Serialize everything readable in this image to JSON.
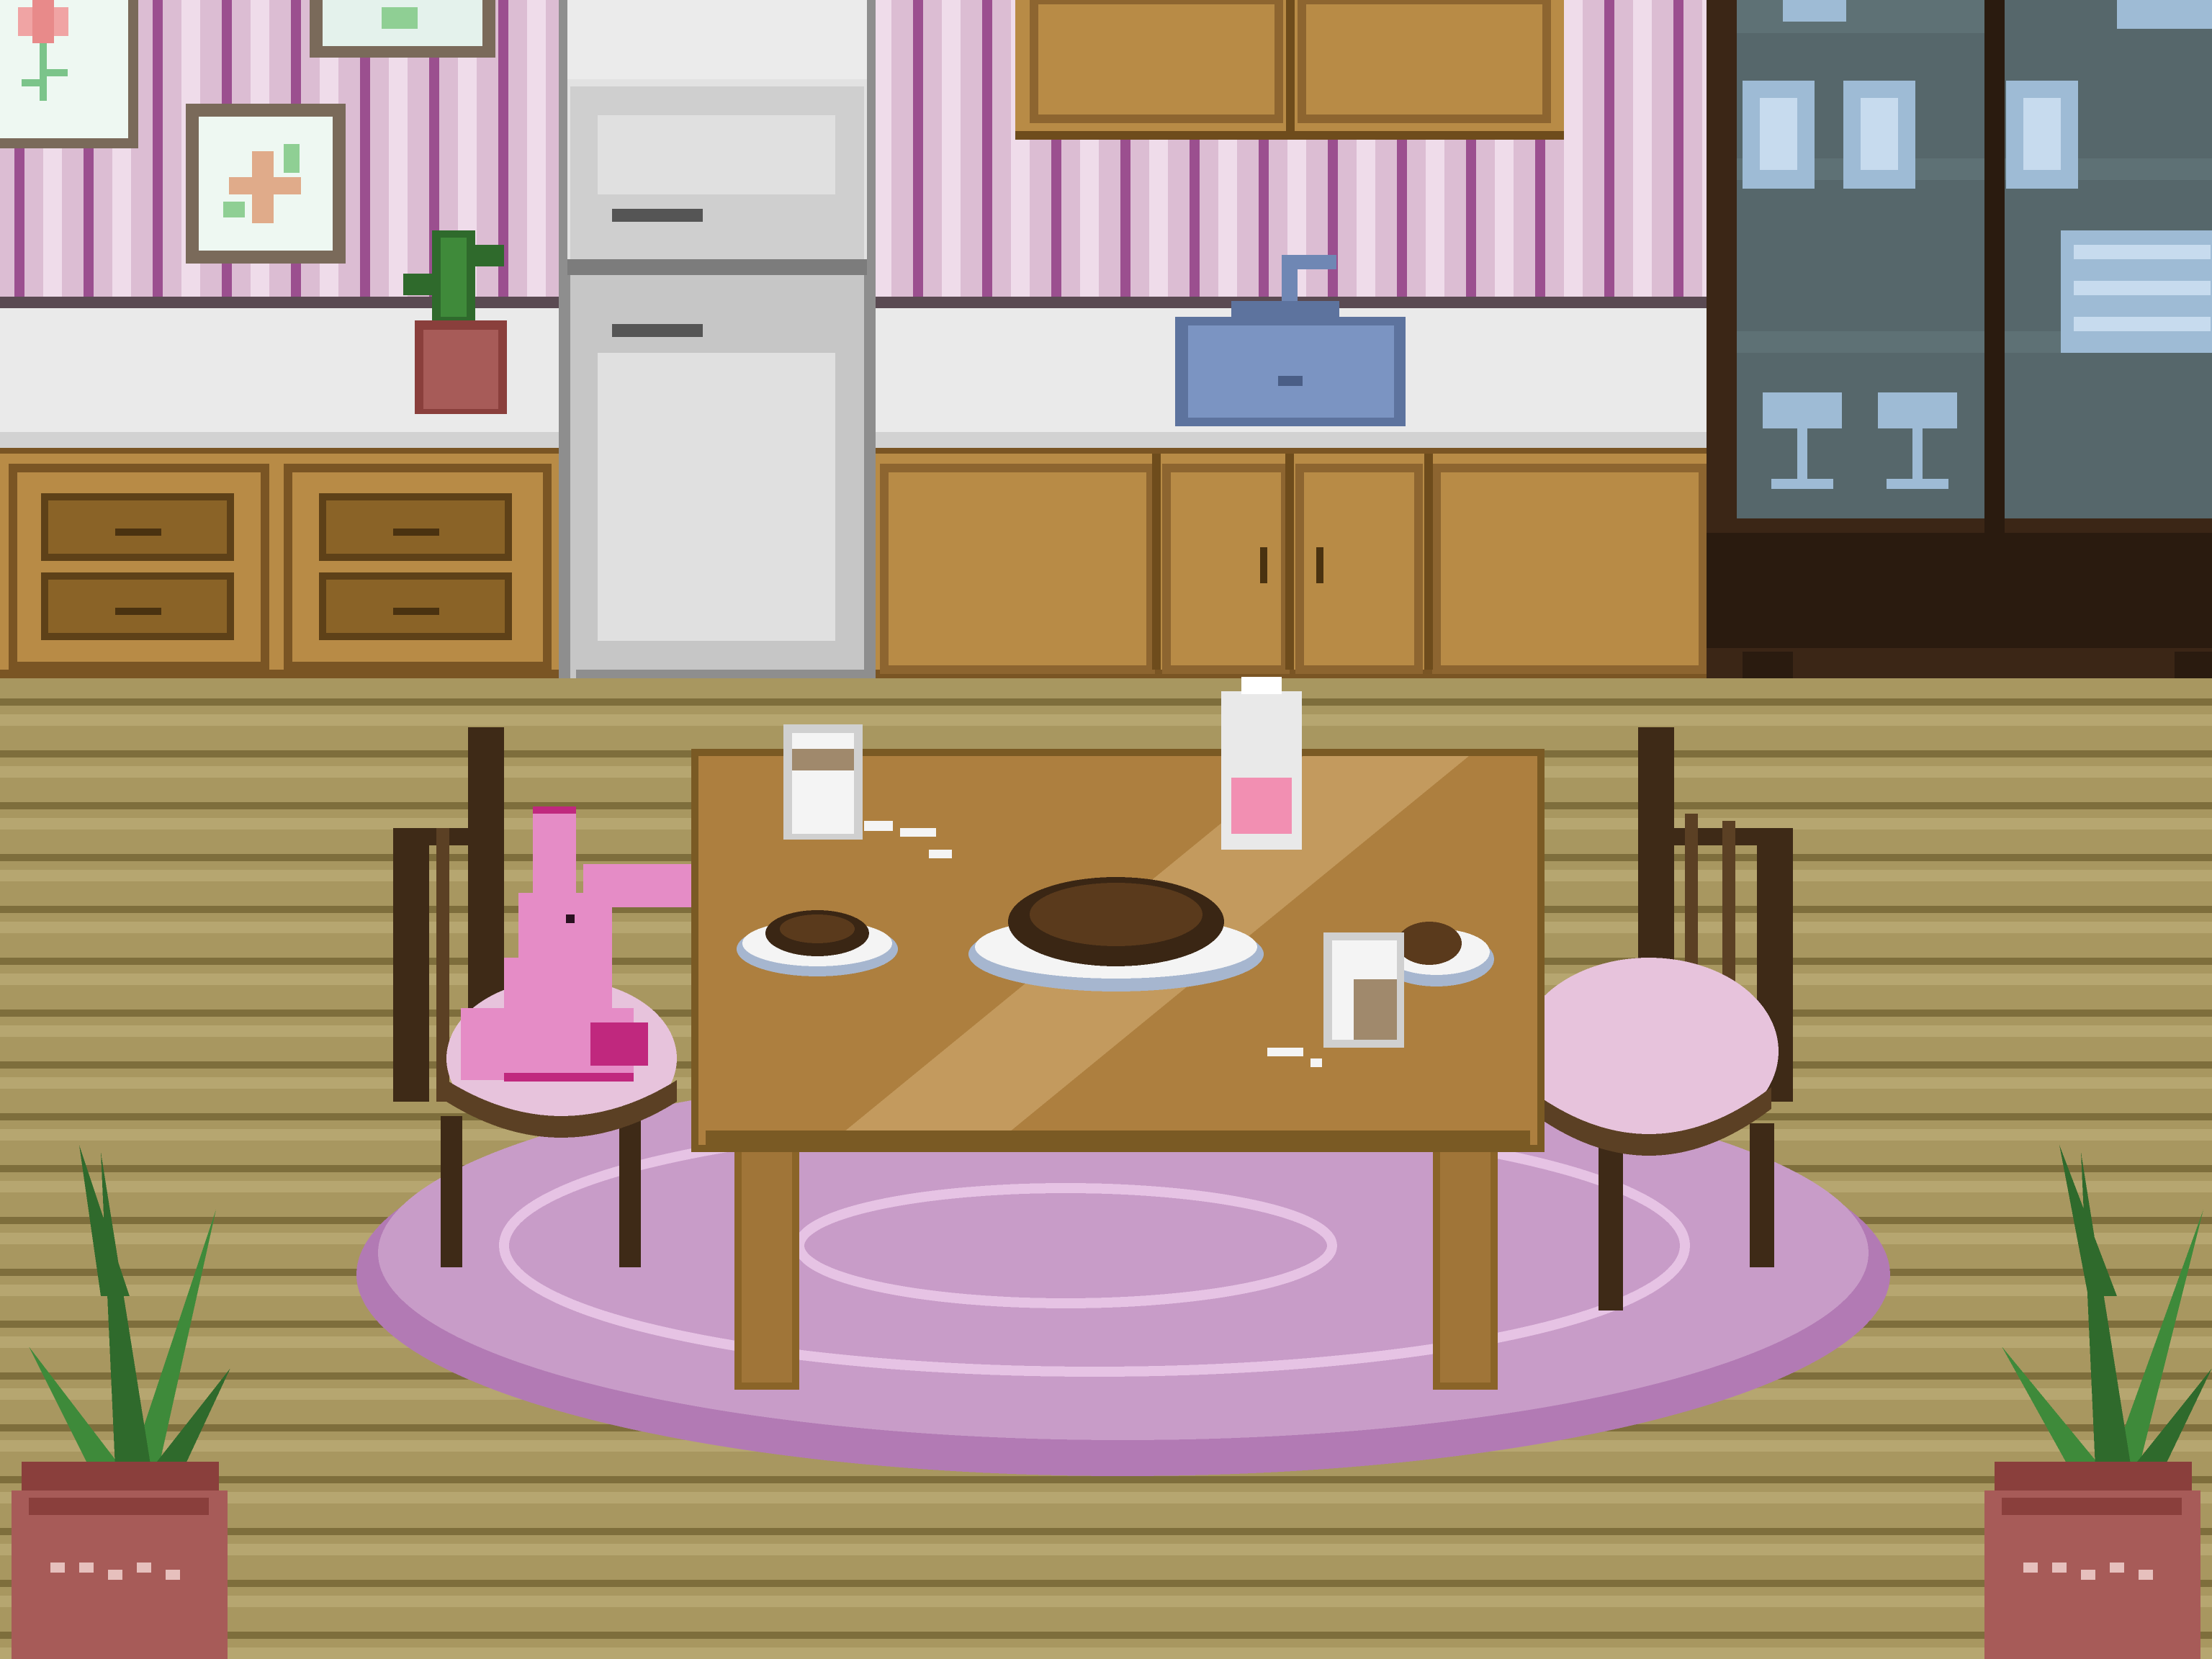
{
  "scene": {
    "type": "pixel-art kitchen dining room",
    "objects": [
      "framed-flower-picture",
      "framed-starfish-picture",
      "potted-cactus",
      "refrigerator",
      "upper-cabinets",
      "kitchen-sink",
      "lower-cabinets",
      "glass-display-cabinet",
      "dining-table",
      "left-chair",
      "right-chair",
      "pink-bunny-plush",
      "milk-carton",
      "milk-glass-left",
      "milk-glass-right",
      "cookie-plates",
      "oval-pink-rug",
      "potted-aloe-left",
      "potted-aloe-right"
    ]
  },
  "colors": {
    "wall_pink": "#d9b8d0",
    "wall_stripe": "#9b4f8f",
    "wood_floor": "#a89760",
    "cabinet_wood": "#b58a44",
    "table_wood": "#ab7e3e",
    "rug_pink": "#c79bc6",
    "fridge_gray": "#c9c9c9",
    "cabinet_glass": "#56676b",
    "bunny_pink": "#e58cc6",
    "plant_green": "#3e8a3a",
    "pot_terracotta": "#a75b58"
  }
}
